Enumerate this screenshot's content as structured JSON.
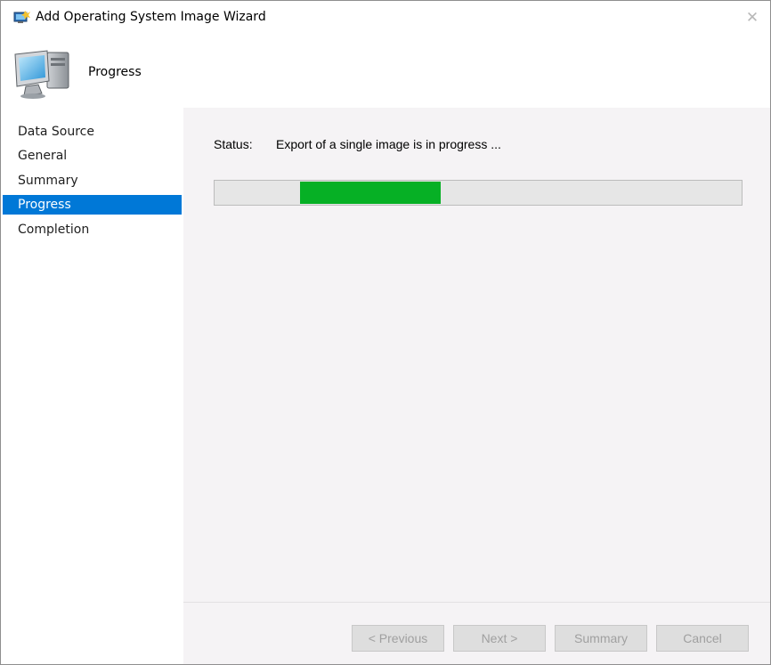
{
  "window": {
    "title": "Add Operating System Image Wizard",
    "close_glyph": "✕"
  },
  "header": {
    "title": "Progress",
    "icon": "computer-monitor-icon"
  },
  "sidebar": {
    "items": [
      {
        "label": "Data Source",
        "active": false
      },
      {
        "label": "General",
        "active": false
      },
      {
        "label": "Summary",
        "active": false
      },
      {
        "label": "Progress",
        "active": true
      },
      {
        "label": "Completion",
        "active": false
      }
    ]
  },
  "main": {
    "status_label": "Status:",
    "status_text": "Export of a single image is in progress ...",
    "progress": {
      "style": "marquee",
      "accent_color": "#06b025"
    }
  },
  "buttons": {
    "previous": "< Previous",
    "next": "Next >",
    "summary": "Summary",
    "cancel": "Cancel"
  },
  "colors": {
    "selection": "#0078d7",
    "content_background": "#f5f3f5"
  }
}
